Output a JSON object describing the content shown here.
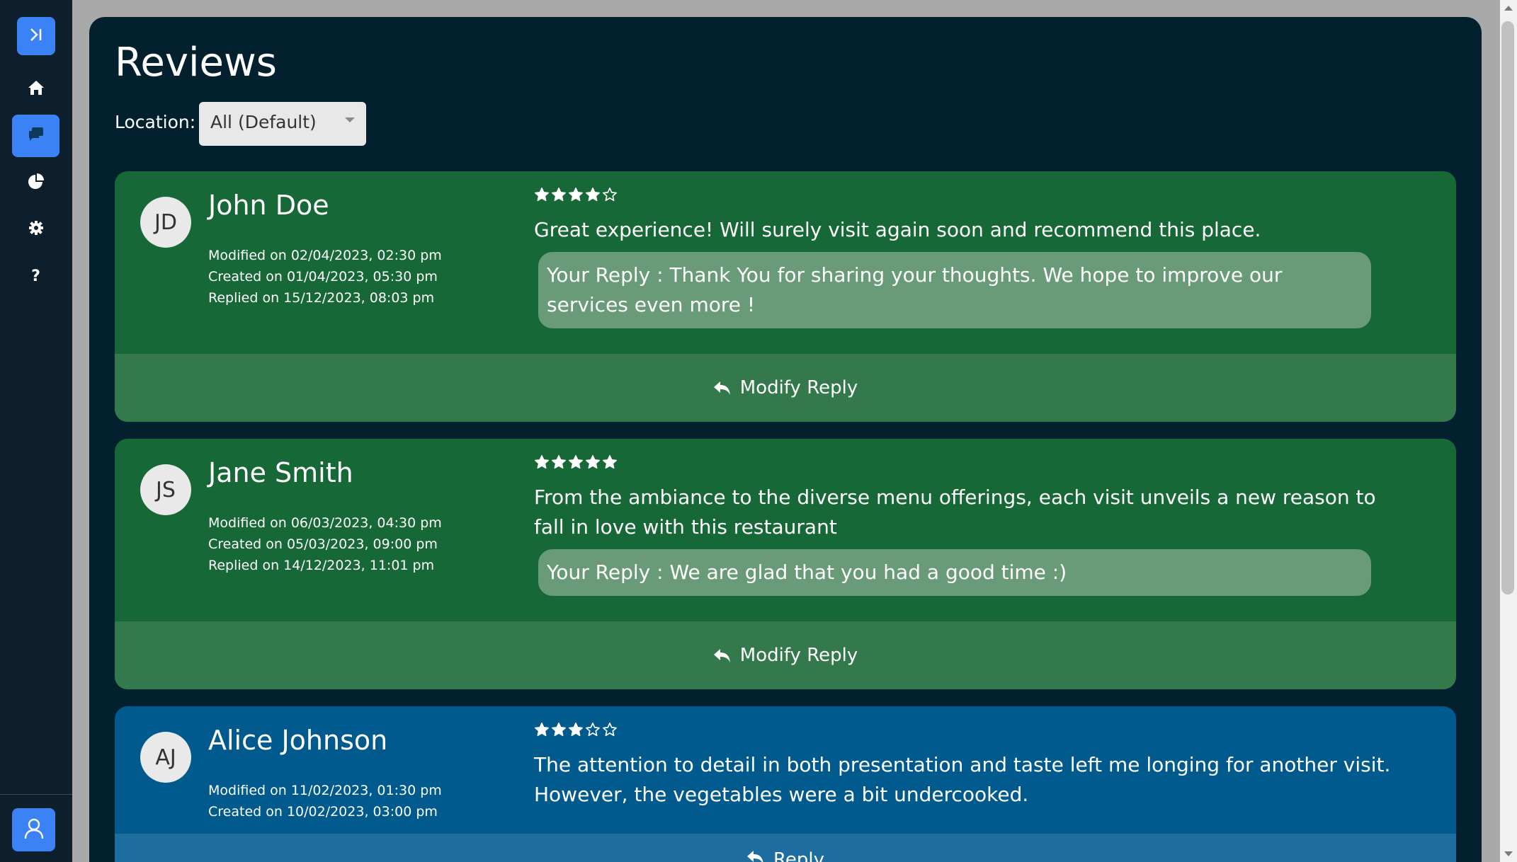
{
  "sidebar": {
    "toggle_icon": "sidebar-expand-icon",
    "items": [
      {
        "name": "home",
        "icon": "home-icon"
      },
      {
        "name": "reviews",
        "icon": "chat-bubbles-icon",
        "active": true
      },
      {
        "name": "analytics",
        "icon": "pie-chart-icon"
      },
      {
        "name": "settings",
        "icon": "gear-icon"
      },
      {
        "name": "help",
        "label": "?"
      }
    ],
    "profile_icon": "user-icon"
  },
  "page": {
    "title": "Reviews",
    "location_label": "Location:",
    "location_value": "All (Default)"
  },
  "colors": {
    "sidebar_bg": "#0d1f2d",
    "main_bg": "#03202f",
    "accent": "#3b82f6",
    "replied_card": "#176837",
    "replied_footer": "#33794c",
    "pending_card": "#005a8e",
    "pending_footer": "#1d6e9e",
    "reply_box": "#6a9b79"
  },
  "reviews": [
    {
      "initials": "JD",
      "name": "John Doe",
      "modified": "Modified on 02/04/2023, 02:30 pm",
      "created": "Created on 01/04/2023, 05:30 pm",
      "replied": "Replied on 15/12/2023, 08:03 pm",
      "rating": 4,
      "text": "Great experience! Will surely visit again soon and recommend this place.",
      "reply": "Your Reply : Thank You for sharing your thoughts. We hope to improve our services even more !",
      "action": "Modify Reply"
    },
    {
      "initials": "JS",
      "name": "Jane Smith",
      "modified": "Modified on 06/03/2023, 04:30 pm",
      "created": "Created on 05/03/2023, 09:00 pm",
      "replied": "Replied on 14/12/2023, 11:01 pm",
      "rating": 5,
      "text": "From the ambiance to the diverse menu offerings, each visit unveils a new reason to fall in love with this restaurant",
      "reply": "Your Reply : We are glad that you had a good time :)",
      "action": "Modify Reply"
    },
    {
      "initials": "AJ",
      "name": "Alice Johnson",
      "modified": "Modified on 11/02/2023, 01:30 pm",
      "created": "Created on 10/02/2023, 03:00 pm",
      "rating": 3,
      "text": "The attention to detail in both presentation and taste left me longing for another visit. However, the vegetables were a bit undercooked.",
      "action": "Reply"
    }
  ]
}
